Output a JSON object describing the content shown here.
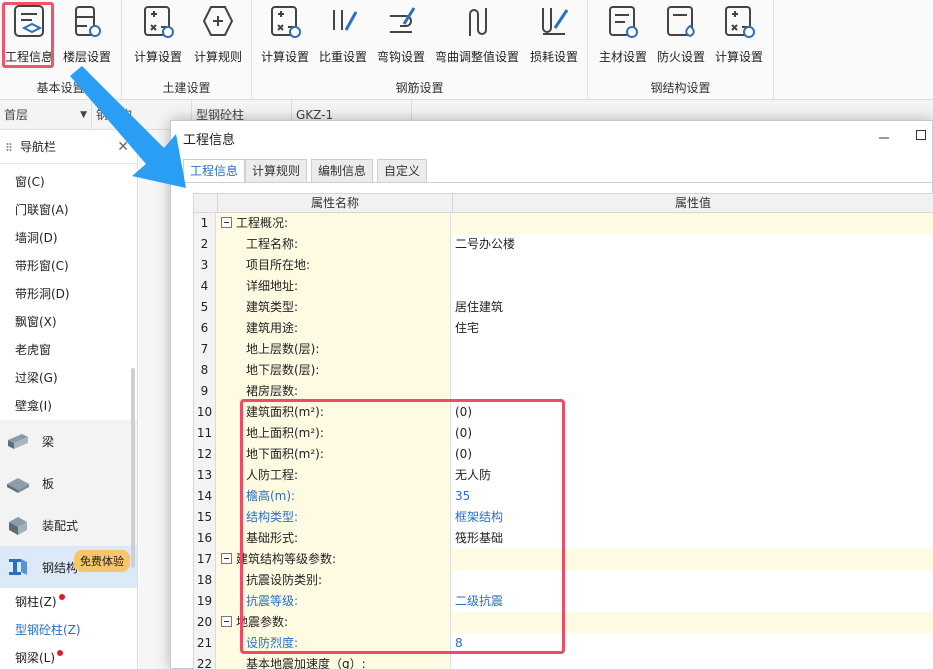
{
  "ribbon": {
    "groups": [
      {
        "label": "基本设置",
        "buttons": [
          "工程信息",
          "楼层设置"
        ]
      },
      {
        "label": "土建设置",
        "buttons": [
          "计算设置",
          "计算规则"
        ]
      },
      {
        "label": "钢筋设置",
        "buttons": [
          "计算设置",
          "比重设置",
          "弯钩设置",
          "弯曲调整值设置",
          "损耗设置"
        ]
      },
      {
        "label": "钢结构设置",
        "buttons": [
          "主材设置",
          "防火设置",
          "计算设置"
        ]
      }
    ]
  },
  "toolbar": {
    "floor": "首层",
    "c2": "钢结构",
    "c3": "型钢砼柱",
    "c4": "GKZ-1"
  },
  "nav": {
    "title": "导航栏",
    "items_top": [
      "窗(C)",
      "门联窗(A)",
      "墙洞(D)",
      "带形窗(C)",
      "带形洞(D)",
      "飘窗(X)",
      "老虎窗",
      "过梁(G)",
      "壁龛(I)"
    ],
    "categories": [
      "梁",
      "板",
      "装配式",
      "钢结构"
    ],
    "badge": "免费体验",
    "items_bottom": [
      "钢柱(Z)",
      "型钢砼柱(Z)",
      "钢梁(L)"
    ]
  },
  "dialog": {
    "title": "工程信息",
    "tabs": [
      "工程信息",
      "计算规则",
      "编制信息",
      "自定义"
    ],
    "columns": [
      "属性名称",
      "属性值"
    ],
    "rows": [
      {
        "n": "1",
        "name": "工程概况:",
        "value": "",
        "group": true
      },
      {
        "n": "2",
        "name": "工程名称:",
        "value": "二号办公楼"
      },
      {
        "n": "3",
        "name": "项目所在地:",
        "value": ""
      },
      {
        "n": "4",
        "name": "详细地址:",
        "value": ""
      },
      {
        "n": "5",
        "name": "建筑类型:",
        "value": "居住建筑"
      },
      {
        "n": "6",
        "name": "建筑用途:",
        "value": "住宅"
      },
      {
        "n": "7",
        "name": "地上层数(层):",
        "value": ""
      },
      {
        "n": "8",
        "name": "地下层数(层):",
        "value": ""
      },
      {
        "n": "9",
        "name": "裙房层数:",
        "value": ""
      },
      {
        "n": "10",
        "name": "建筑面积(m²):",
        "value": "(0)"
      },
      {
        "n": "11",
        "name": "地上面积(m²):",
        "value": "(0)"
      },
      {
        "n": "12",
        "name": "地下面积(m²):",
        "value": "(0)"
      },
      {
        "n": "13",
        "name": "人防工程:",
        "value": "无人防"
      },
      {
        "n": "14",
        "name": "檐高(m):",
        "value": "35",
        "blue": true
      },
      {
        "n": "15",
        "name": "结构类型:",
        "value": "框架结构",
        "blue": true
      },
      {
        "n": "16",
        "name": "基础形式:",
        "value": "筏形基础"
      },
      {
        "n": "17",
        "name": "建筑结构等级参数:",
        "value": "",
        "group": true
      },
      {
        "n": "18",
        "name": "抗震设防类别:",
        "value": ""
      },
      {
        "n": "19",
        "name": "抗震等级:",
        "value": "二级抗震",
        "blue": true
      },
      {
        "n": "20",
        "name": "地震参数:",
        "value": "",
        "group": true
      },
      {
        "n": "21",
        "name": "设防烈度:",
        "value": "8",
        "blue": true
      },
      {
        "n": "22",
        "name": "基本地震加速度（g）:",
        "value": ""
      }
    ]
  },
  "colors": {
    "accent": "#2a6fc2",
    "highlight": "#ef4b63",
    "arrow": "#2a9df4"
  }
}
